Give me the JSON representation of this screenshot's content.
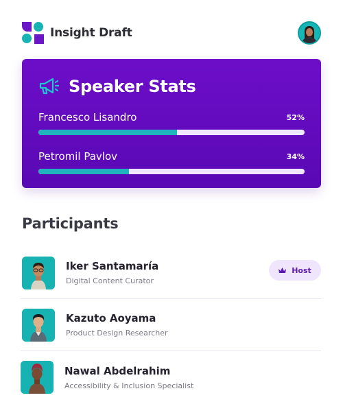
{
  "app": {
    "name": "Insight Draft",
    "logo_icon": "insight-draft-logo"
  },
  "user": {
    "avatar_icon": "user-avatar"
  },
  "stats": {
    "title": "Speaker Stats",
    "icon": "megaphone-icon",
    "speakers": [
      {
        "name": "Francesco Lisandro",
        "percent_label": "52%",
        "percent": 52
      },
      {
        "name": "Petromil Pavlov",
        "percent_label": "34%",
        "percent": 34
      }
    ]
  },
  "participants": {
    "title": "Participants",
    "items": [
      {
        "name": "Iker Santamaría",
        "role": "Digital Content Curator",
        "badge": "Host",
        "badge_icon": "crown-icon"
      },
      {
        "name": "Kazuto Aoyama",
        "role": "Product Design Researcher"
      },
      {
        "name": "Nawal Abdelrahim",
        "role": "Accessibility & Inclusion Specialist"
      }
    ]
  },
  "colors": {
    "card_purple": "#6d0ec9",
    "accent_teal": "#1eb3bd",
    "track": "#f1e6ff",
    "badge_bg": "#efe5fc",
    "badge_text": "#5d1bb2"
  }
}
